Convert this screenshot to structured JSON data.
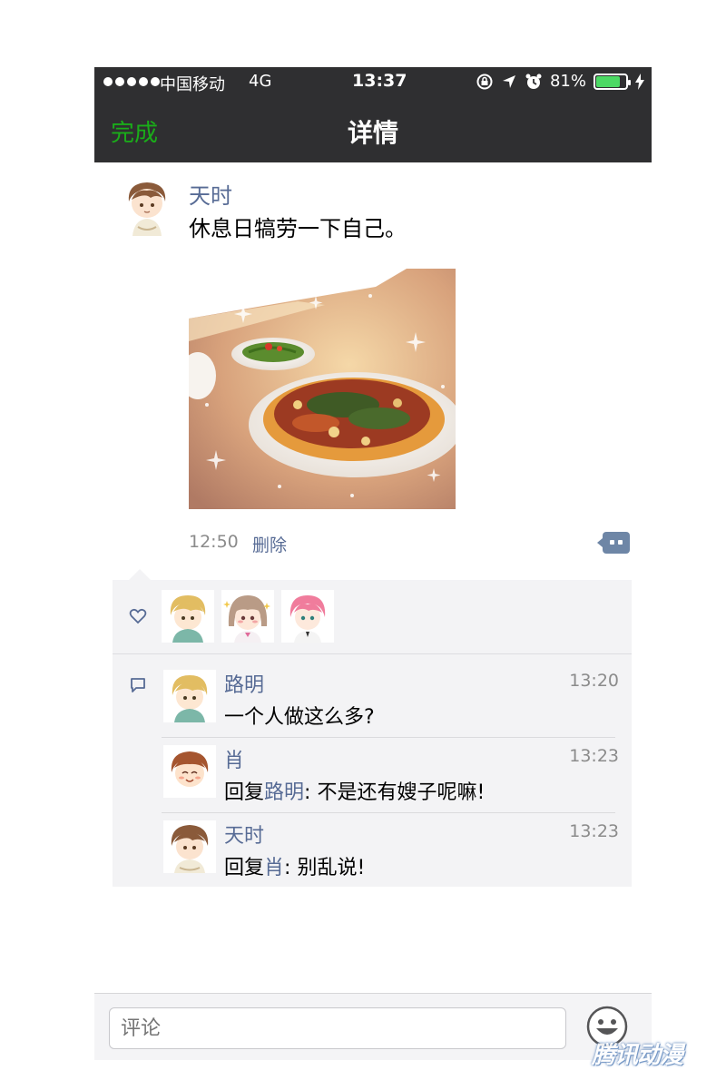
{
  "status_bar": {
    "carrier": "中国移动",
    "network": "4G",
    "time": "13:37",
    "battery": "81%",
    "battery_level": 0.81
  },
  "nav": {
    "done_label": "完成",
    "title": "详情"
  },
  "post": {
    "author": "天时",
    "text": "休息日犒劳一下自己。",
    "time": "12:50",
    "delete_label": "删除"
  },
  "likes": {
    "avatars": [
      "路明",
      "女生",
      "粉发"
    ]
  },
  "comments": [
    {
      "name": "路明",
      "time": "13:20",
      "prefix": "",
      "mention": "",
      "sep": "",
      "text": "一个人做这么多?"
    },
    {
      "name": "肖",
      "time": "13:23",
      "prefix": "回复",
      "mention": "路明",
      "sep": ": ",
      "text": "不是还有嫂子呢嘛!"
    },
    {
      "name": "天时",
      "time": "13:23",
      "prefix": "回复",
      "mention": "肖",
      "sep": ": ",
      "text": "别乱说!"
    }
  ],
  "input": {
    "placeholder": "评论"
  },
  "watermark": "腾讯动漫",
  "colors": {
    "accent_green": "#1aad19",
    "link_blue": "#576b95",
    "bar_dark": "#2f2f31"
  },
  "icons": [
    "signal-icon",
    "rotation-lock-icon",
    "location-icon",
    "alarm-icon",
    "battery-icon",
    "charging-icon",
    "comment-action-icon",
    "heart-icon",
    "comment-bubble-icon",
    "emoji-icon"
  ]
}
